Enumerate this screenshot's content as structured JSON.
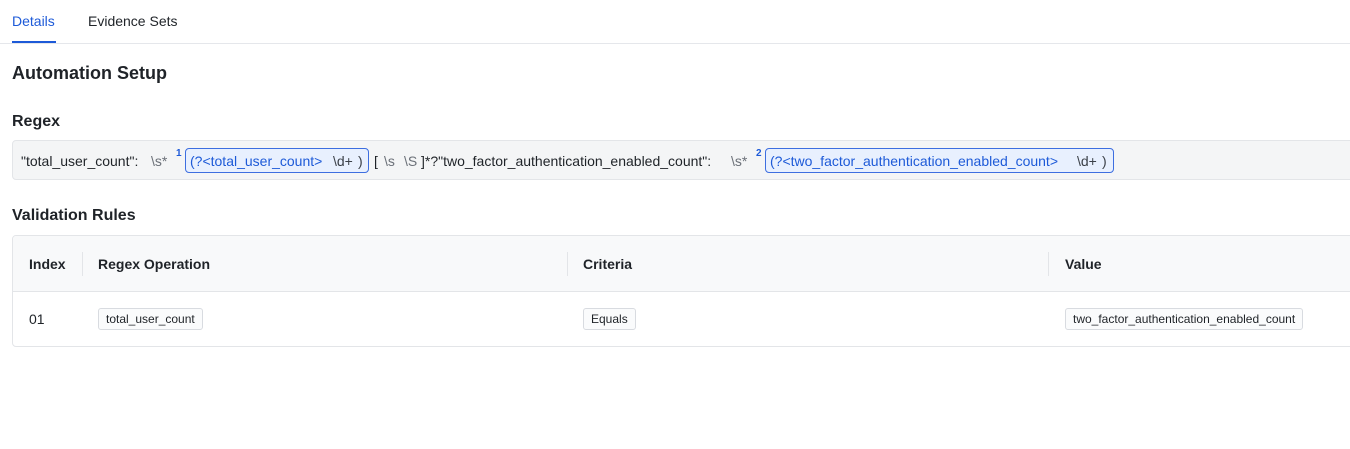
{
  "tabs": [
    {
      "label": "Details",
      "active": true
    },
    {
      "label": "Evidence Sets",
      "active": false
    }
  ],
  "sections": {
    "automation_title": "Automation Setup",
    "regex_title": "Regex",
    "validation_title": "Validation Rules"
  },
  "regex": {
    "part1": "\"total_user_count\":",
    "ws1": "\\s*",
    "group1": {
      "index": "1",
      "open": "(?<total_user_count>",
      "pattern": "\\d+",
      "close": ")"
    },
    "class_open": "[",
    "class_s": "\\s",
    "class_S": "\\S",
    "class_close": "]*?\"two_factor_authentication_enabled_count\":",
    "ws2": "\\s*",
    "group2": {
      "index": "2",
      "open": "(?<two_factor_authentication_enabled_count>",
      "pattern": "\\d+",
      "close": ")"
    }
  },
  "table": {
    "headers": [
      "Index",
      "Regex Operation",
      "Criteria",
      "Value"
    ],
    "rows": [
      {
        "index": "01",
        "operation": "total_user_count",
        "criteria": "Equals",
        "value": "two_factor_authentication_enabled_count"
      }
    ]
  },
  "colors": {
    "accent": "#1d5ad8",
    "group_bg": "#e8f0fe",
    "border": "#e3e5e8"
  }
}
